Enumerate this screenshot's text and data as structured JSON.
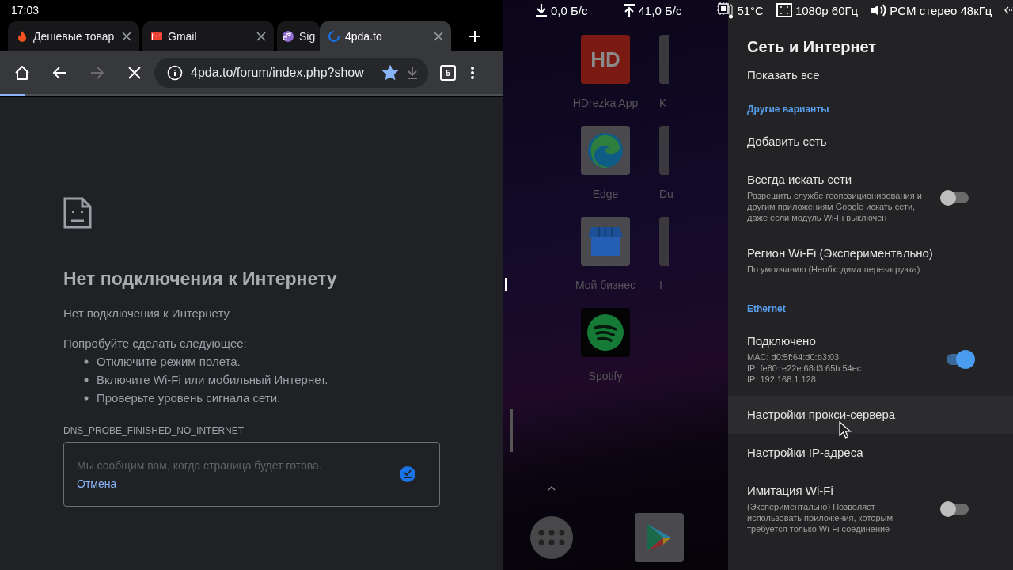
{
  "status_bar": {
    "time": "17:03",
    "stats": [
      {
        "kind": "download",
        "text": "0,0 Б/с"
      },
      {
        "kind": "upload",
        "text": "41,0 Б/с"
      },
      {
        "kind": "temperature",
        "text": "51°C"
      },
      {
        "kind": "display",
        "text": "1080p 60Гц"
      },
      {
        "kind": "audio",
        "text": "PCM стерео 48кГц"
      },
      {
        "kind": "link"
      }
    ]
  },
  "browser": {
    "tabs": [
      {
        "title": "Дешевые товар",
        "selected": false,
        "closable": true
      },
      {
        "title": "Gmail",
        "selected": false,
        "closable": true
      },
      {
        "title": "Sig",
        "selected": false,
        "closable": false
      },
      {
        "title": "4pda.to",
        "selected": true,
        "closable": true
      }
    ],
    "url": "4pda.to/forum/index.php?show",
    "bookmarked": true,
    "tab_count": "5",
    "forward_disabled": true,
    "loading": {
      "level": 0.05
    },
    "error": {
      "heading": "Нет подключения к Интернету",
      "message": "Нет подключения к Интернету",
      "suggest_intro": "Попробуйте сделать следующее:",
      "suggestions": [
        "Отключите режим полета.",
        "Включите Wi-Fi или мобильный Интернет.",
        "Проверьте уровень сигнала сети."
      ],
      "code": "DNS_PROBE_FINISHED_NO_INTERNET",
      "notice": "Мы сообщим вам, когда страница будет готова.",
      "cancel": "Отмена"
    }
  },
  "launcher": {
    "apps": [
      {
        "label": "HDrezka App",
        "logo": "HD"
      },
      {
        "label": "Edge"
      },
      {
        "label": "Мой бизнес"
      },
      {
        "label": "Spotify"
      }
    ],
    "column_2": [
      "K",
      "Du",
      "I"
    ]
  },
  "settings": {
    "title": "Сеть и Интернет",
    "items": [
      {
        "kind": "item",
        "title": "Показать все"
      },
      {
        "kind": "header",
        "title": "Другие варианты"
      },
      {
        "kind": "item",
        "title": "Добавить сеть"
      },
      {
        "kind": "toggle",
        "title": "Всегда искать сети",
        "lines": [
          "Разрешить службе геопозиционирования и",
          "другим приложениям Google искать сети,",
          "даже если модуль Wi-Fi выключен"
        ],
        "on": false
      },
      {
        "kind": "item",
        "title": "Регион Wi-Fi (Экспериментально)",
        "lines": [
          "По умолчанию (Необходима перезагрузка)"
        ]
      },
      {
        "kind": "header",
        "title": "Ethernet"
      },
      {
        "kind": "toggle",
        "title": "Подключено",
        "lines": [
          "MAC: d0:5f:64:d0:b3:03",
          "IP: fe80::e22e:68d3:65b:54ec",
          "IP: 192.168.1.128"
        ],
        "on": true
      },
      {
        "kind": "item",
        "title": "Настройки прокси-сервера",
        "hovered": true
      },
      {
        "kind": "item",
        "title": "Настройки IP-адреса"
      },
      {
        "kind": "toggle",
        "title": "Имитация Wi-Fi",
        "lines": [
          "(Экспериментально) Позволяет",
          "использовать приложения, которым",
          "требуется только Wi-Fi соединение"
        ],
        "on": false
      }
    ]
  }
}
